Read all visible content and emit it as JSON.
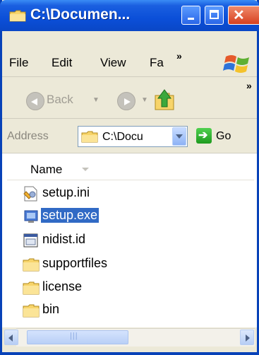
{
  "window": {
    "title": "C:\\Documen...",
    "close_glyph": "✕"
  },
  "menubar": {
    "items": [
      "File",
      "Edit",
      "View",
      "Fa"
    ],
    "overflow_glyph": "»"
  },
  "toolbar": {
    "back_label": "Back",
    "overflow_glyph": "»"
  },
  "address": {
    "label": "Address",
    "value": "C:\\Docu",
    "go_label": "Go"
  },
  "list": {
    "column_header": "Name",
    "items": [
      {
        "name": "setup.ini",
        "icon": "ini-file-icon",
        "selected": false
      },
      {
        "name": "setup.exe",
        "icon": "exe-file-icon",
        "selected": true
      },
      {
        "name": "nidist.id",
        "icon": "id-file-icon",
        "selected": false
      },
      {
        "name": "supportfiles",
        "icon": "folder-icon",
        "selected": false
      },
      {
        "name": "license",
        "icon": "folder-icon",
        "selected": false
      },
      {
        "name": "bin",
        "icon": "folder-icon",
        "selected": false
      }
    ]
  },
  "colors": {
    "titlebar": "#0b4fd8",
    "selection": "#316ac5",
    "chrome": "#ece9d8"
  }
}
